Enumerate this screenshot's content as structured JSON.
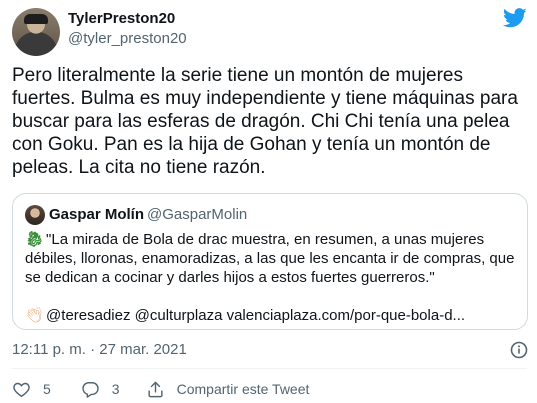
{
  "tweet": {
    "author": {
      "display_name": "TylerPreston20",
      "handle": "@tyler_preston20"
    },
    "text": "Pero literalmente la serie tiene un montón de mujeres fuertes. Bulma es muy independiente y tiene máquinas para buscar para las esferas de dragón. Chi Chi tenía una pelea con Goku. Pan es la hija de Gohan y tenía un montón de peleas. La cita no tiene razón.",
    "quoted": {
      "display_name": "Gaspar Molín",
      "handle": "@GasparMolin",
      "text": "\"La mirada de Bola de drac muestra, en resumen, a unas mujeres débiles, lloronas, enamoradizas, a las que les encanta ir de compras, que se dedican a cocinar y darles hijos a estos fuertes guerreros.\"",
      "footer": "@teresadiez @culturplaza valenciaplaza.com/por-que-bola-d..."
    },
    "timestamp": "12:11 p. m. · 27 mar. 2021",
    "actions": {
      "likes": "5",
      "replies": "3",
      "share_label": "Compartir este Tweet"
    }
  },
  "colors": {
    "brand": "#1d9bf0",
    "text": "#0f1419",
    "secondary": "#536471",
    "border": "#cfd9de"
  },
  "icons": [
    "twitter-bird-icon",
    "info-icon",
    "heart-icon",
    "reply-icon",
    "share-icon",
    "dragon-emoji-icon",
    "clapping-hands-emoji-icon"
  ]
}
